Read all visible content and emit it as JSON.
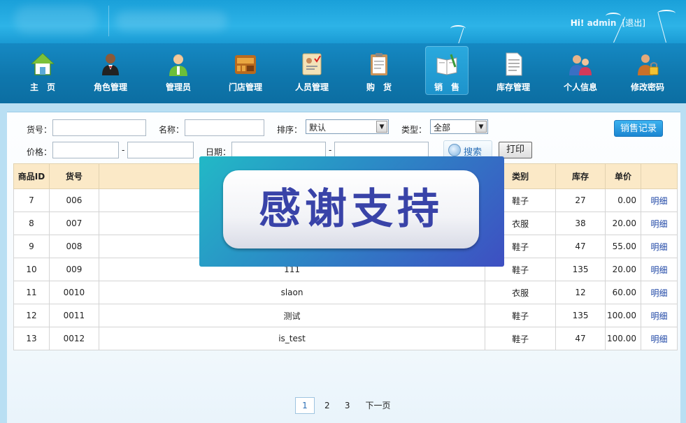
{
  "header": {
    "greeting": "Hi!",
    "username": "admin",
    "logout_label": "[退出]"
  },
  "nav": {
    "items": [
      {
        "label": "主　页",
        "icon": "home-icon"
      },
      {
        "label": "角色管理",
        "icon": "waiter-icon"
      },
      {
        "label": "管理员",
        "icon": "admin-user-icon"
      },
      {
        "label": "门店管理",
        "icon": "store-icon"
      },
      {
        "label": "人员管理",
        "icon": "staff-card-icon"
      },
      {
        "label": "购　货",
        "icon": "purchase-clipboard-icon"
      },
      {
        "label": "销　售",
        "icon": "sales-book-icon"
      },
      {
        "label": "库存管理",
        "icon": "inventory-doc-icon"
      },
      {
        "label": "个人信息",
        "icon": "people-icon"
      },
      {
        "label": "修改密码",
        "icon": "lock-user-icon"
      }
    ],
    "active": "销　售"
  },
  "filters": {
    "sku_label": "货号：",
    "name_label": "名称：",
    "sort_label": "排序：",
    "sort_value": "默认",
    "type_label": "类型：",
    "type_value": "全部",
    "price_label": "价格：",
    "date_label": "日期：",
    "dash": "-",
    "search_label": "搜索",
    "print_label": "打印",
    "sales_record_label": "销售记录"
  },
  "table": {
    "columns": [
      "商品ID",
      "货号",
      "",
      "类别",
      "库存",
      "单价",
      ""
    ],
    "rows": [
      {
        "id": "7",
        "sku": "006",
        "name": "",
        "category": "鞋子",
        "stock": "27",
        "price": "0.00",
        "action": "明细"
      },
      {
        "id": "8",
        "sku": "007",
        "name": "",
        "category": "衣服",
        "stock": "38",
        "price": "20.00",
        "action": "明细"
      },
      {
        "id": "9",
        "sku": "008",
        "name": "",
        "category": "鞋子",
        "stock": "47",
        "price": "55.00",
        "action": "明细"
      },
      {
        "id": "10",
        "sku": "009",
        "name": "111",
        "category": "鞋子",
        "stock": "135",
        "price": "20.00",
        "action": "明细"
      },
      {
        "id": "11",
        "sku": "0010",
        "name": "slaon",
        "category": "衣服",
        "stock": "12",
        "price": "60.00",
        "action": "明细"
      },
      {
        "id": "12",
        "sku": "0011",
        "name": "测试",
        "category": "鞋子",
        "stock": "135",
        "price": "100.00",
        "action": "明细"
      },
      {
        "id": "13",
        "sku": "0012",
        "name": "is_test",
        "category": "鞋子",
        "stock": "47",
        "price": "100.00",
        "action": "明细"
      }
    ]
  },
  "pager": {
    "pages": [
      "1",
      "2",
      "3"
    ],
    "current": "1",
    "next_label": "下一页"
  },
  "overlay": {
    "text": "感谢支持"
  },
  "colors": {
    "header_blue": "#1aa0d9",
    "nav_blue": "#0f77ad",
    "table_header_bg": "#fbe9c7",
    "link_blue": "#1f47a6",
    "overlay_text": "#3943a8"
  }
}
